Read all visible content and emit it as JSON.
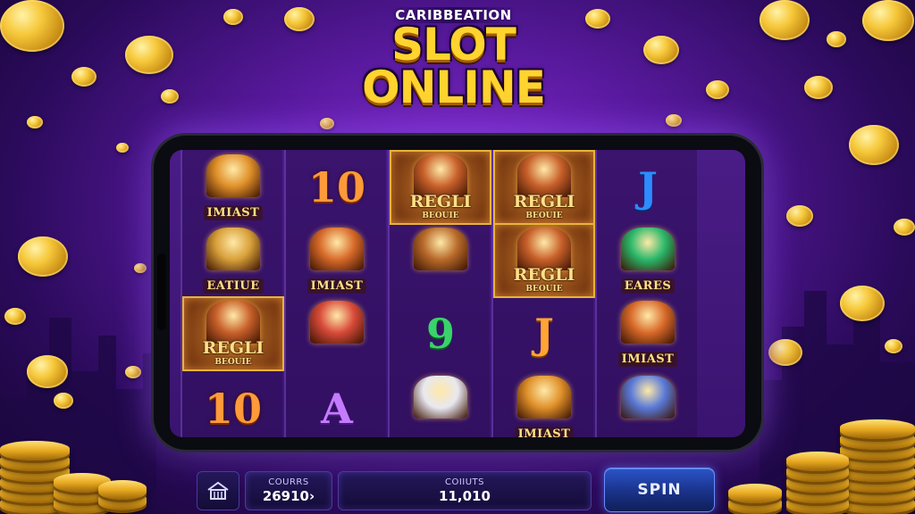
{
  "header": {
    "subtitle": "CARIBBEATION",
    "title_line1": "SLOT",
    "title_line2": "ONLINE"
  },
  "reels": [
    {
      "symbols": [
        {
          "type": "emblem",
          "label": "IMIAST",
          "framed": false,
          "color": "#e0902a"
        },
        {
          "type": "emblem",
          "label": "EATIUE",
          "framed": false,
          "color": "#d8a03a"
        },
        {
          "type": "emblem",
          "label": "REGLI",
          "sublabel": "BEOUIE",
          "framed": true,
          "color": "#c8602a"
        },
        {
          "type": "glyph",
          "value": "10",
          "style": "g-10"
        }
      ]
    },
    {
      "symbols": [
        {
          "type": "glyph",
          "value": "10",
          "style": "g-10"
        },
        {
          "type": "emblem",
          "label": "IMIAST",
          "framed": false,
          "color": "#d86a2a"
        },
        {
          "type": "emblem",
          "label": "",
          "framed": false,
          "color": "#d84a3a"
        },
        {
          "type": "glyph",
          "value": "A",
          "style": "g-A"
        }
      ]
    },
    {
      "symbols": [
        {
          "type": "emblem",
          "label": "REGLI",
          "sublabel": "BEOUIE",
          "framed": true,
          "color": "#c8602a"
        },
        {
          "type": "emblem",
          "label": "",
          "framed": false,
          "color": "#b86a2a"
        },
        {
          "type": "glyph",
          "value": "9",
          "style": "g-9"
        },
        {
          "type": "emblem",
          "label": "",
          "framed": false,
          "color": "#e8e8f0"
        }
      ]
    },
    {
      "symbols": [
        {
          "type": "emblem",
          "label": "REGLI",
          "sublabel": "BEOUIE",
          "framed": true,
          "color": "#c8602a"
        },
        {
          "type": "emblem",
          "label": "REGLI",
          "sublabel": "BEOUIE",
          "framed": true,
          "color": "#c8602a"
        },
        {
          "type": "glyph",
          "value": "J",
          "style": "g-J2"
        },
        {
          "type": "emblem",
          "label": "IMIAST",
          "framed": false,
          "color": "#e0902a"
        }
      ]
    },
    {
      "symbols": [
        {
          "type": "glyph",
          "value": "J",
          "style": "g-J"
        },
        {
          "type": "emblem",
          "label": "EARES",
          "framed": false,
          "color": "#2ab86a"
        },
        {
          "type": "emblem",
          "label": "IMIAST",
          "framed": false,
          "color": "#d86a2a"
        },
        {
          "type": "emblem",
          "label": "",
          "framed": false,
          "color": "#5a7ad8"
        }
      ]
    }
  ],
  "hud": {
    "home_icon": "home-icon",
    "credits_label": "COURRS",
    "credits_value": "26910&#39;",
    "coins_label": "COIIUTS",
    "coins_value": "11,010",
    "spin_label": "SPIN"
  },
  "colors": {
    "background": "#5a1aa0",
    "gold": "#f6c83a",
    "spin": "#2a54c8"
  }
}
